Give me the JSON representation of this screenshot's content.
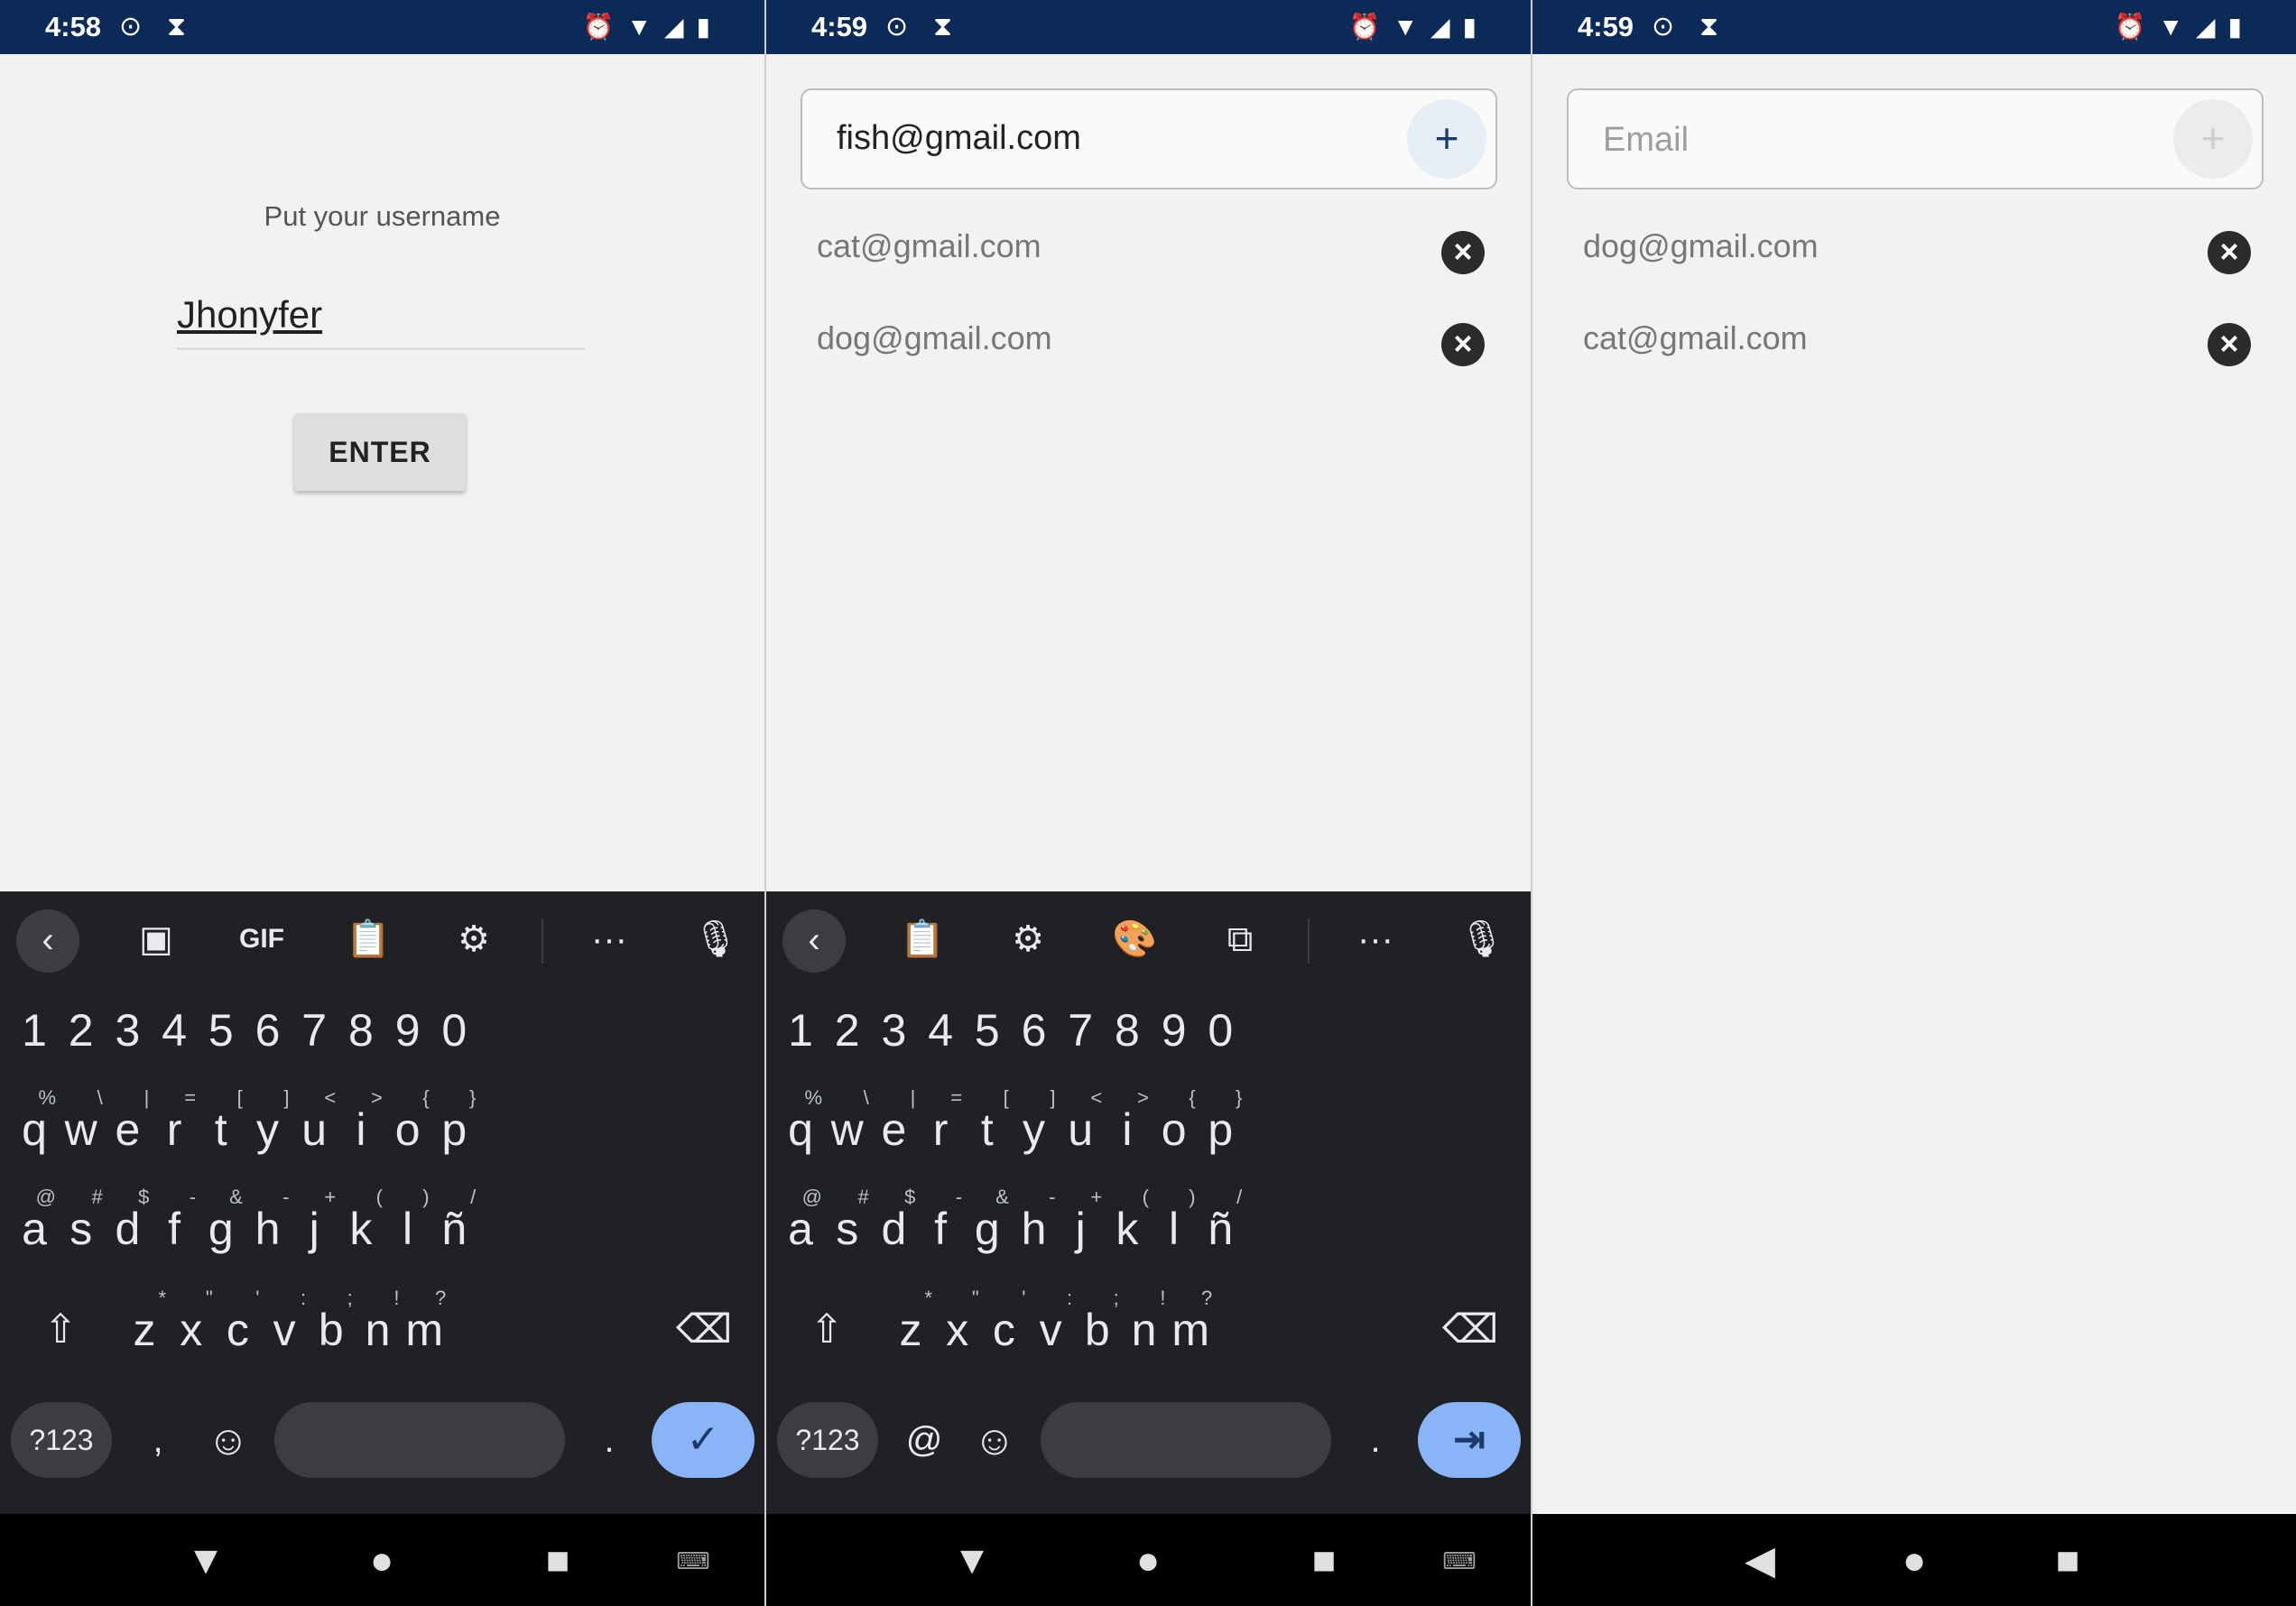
{
  "screens": [
    {
      "status": {
        "time": "4:58"
      },
      "login": {
        "prompt": "Put your username",
        "username_value": "Jhonyfer",
        "enter_label": "ENTER"
      },
      "keyboard": {
        "toolbar": [
          "back-icon",
          "sticker-icon",
          "GIF",
          "clipboard-icon",
          "gear-icon",
          "more-icon",
          "mic-icon"
        ],
        "sym_label": "?123",
        "comma": ",",
        "period": ".",
        "action": "check-icon"
      },
      "nav": [
        "back-triangle",
        "home-circle",
        "recents-square",
        "keyboard-switch"
      ]
    },
    {
      "status": {
        "time": "4:59"
      },
      "email_input": {
        "value": "fish@gmail.com",
        "add_label": "+"
      },
      "emails": [
        "cat@gmail.com",
        "dog@gmail.com"
      ],
      "keyboard": {
        "toolbar": [
          "back-icon",
          "clipboard-icon",
          "gear-icon",
          "palette-icon",
          "resize-icon",
          "more-icon",
          "mic-off-icon"
        ],
        "sym_label": "?123",
        "at": "@",
        "period": ".",
        "action": "tab-icon"
      },
      "nav": [
        "back-triangle",
        "home-circle",
        "recents-square",
        "keyboard-switch"
      ]
    },
    {
      "status": {
        "time": "4:59"
      },
      "email_input": {
        "placeholder": "Email",
        "add_label": "+"
      },
      "emails": [
        "dog@gmail.com",
        "cat@gmail.com"
      ],
      "nav": [
        "back-triangle",
        "home-circle",
        "recents-square"
      ]
    }
  ],
  "keyboard_rows": {
    "numbers": [
      "1",
      "2",
      "3",
      "4",
      "5",
      "6",
      "7",
      "8",
      "9",
      "0"
    ],
    "row1": [
      [
        "q",
        "%"
      ],
      [
        "w",
        "\\"
      ],
      [
        "e",
        "|"
      ],
      [
        "r",
        "="
      ],
      [
        "t",
        "["
      ],
      [
        "y",
        "]"
      ],
      [
        "u",
        "<"
      ],
      [
        "i",
        ">"
      ],
      [
        "o",
        "{"
      ],
      [
        "p",
        "}"
      ]
    ],
    "row2": [
      [
        "a",
        "@"
      ],
      [
        "s",
        "#"
      ],
      [
        "d",
        "$"
      ],
      [
        "f",
        "-"
      ],
      [
        "g",
        "&"
      ],
      [
        "h",
        "-"
      ],
      [
        "j",
        "+"
      ],
      [
        "k",
        "("
      ],
      [
        "l",
        ")"
      ],
      [
        "ñ",
        "/"
      ]
    ],
    "row3": [
      [
        "z",
        "*"
      ],
      [
        "x",
        "\""
      ],
      [
        "c",
        "'"
      ],
      [
        "v",
        ":"
      ],
      [
        "b",
        ";"
      ],
      [
        "n",
        "!"
      ],
      [
        "m",
        "?"
      ]
    ]
  },
  "colors": {
    "status_bar": "#0b2a57",
    "keyboard_bg": "#202124",
    "accent_key": "#8ab4f8"
  }
}
